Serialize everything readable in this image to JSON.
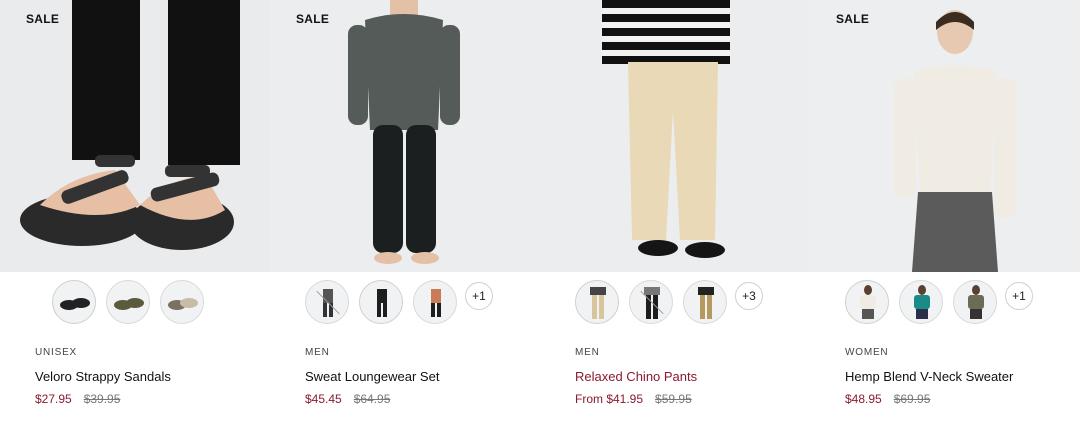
{
  "products": [
    {
      "badge": "SALE",
      "category": "UNISEX",
      "name": "Veloro Strappy Sandals",
      "price": "$27.95",
      "original_price": "$39.95",
      "more": "",
      "swatches": [
        "black",
        "khaki",
        "beige"
      ]
    },
    {
      "badge": "SALE",
      "category": "MEN",
      "name": "Sweat Loungewear Set",
      "price": "$45.45",
      "original_price": "$64.95",
      "more": "+1",
      "swatches": [
        "grey",
        "black",
        "orange"
      ]
    },
    {
      "badge": "",
      "category": "MEN",
      "name": "Relaxed Chino Pants",
      "price": "From $41.95",
      "original_price": "$59.95",
      "more": "+3",
      "swatches": [
        "beige",
        "black",
        "khaki"
      ]
    },
    {
      "badge": "SALE",
      "category": "WOMEN",
      "name": "Hemp Blend V-Neck Sweater",
      "price": "$48.95",
      "original_price": "$69.95",
      "more": "+1",
      "swatches": [
        "white",
        "teal",
        "olive"
      ]
    }
  ],
  "colors": {
    "sale_price": "#8a1a2e",
    "photo_background": "#eef0f1"
  }
}
